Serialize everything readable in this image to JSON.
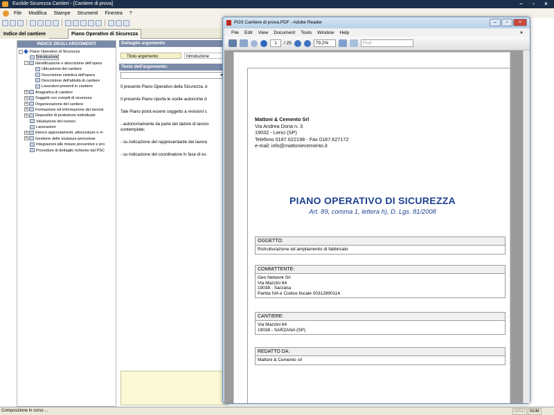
{
  "app": {
    "title": "Euclide Sicurezza Cantieri - [Cantiere di prova]"
  },
  "menubar": [
    "File",
    "Modifica",
    "Stampe",
    "Strumenti",
    "Finestra",
    "?"
  ],
  "tabs": [
    "Indice del cantiere",
    "Piano Operativo di Sicurezza"
  ],
  "left": {
    "header": "INDICE DEGLI ARGOMENTI",
    "tree": [
      "Piano Operativo di Sicurezza",
      "Introduzione",
      "Identificazione e descrizione dell'opera",
      "Ubicazione del cantiere",
      "Descrizione sintetica dell'opera",
      "Descrizione dell'attività di cantiere",
      "Lavoratori presenti in cantiere",
      "Anagrafica di cantiere",
      "Soggetti con compiti di sicurezza",
      "Organizzazione del cantiere",
      "Formazione ed informazione dei lavorat",
      "Dispositivi di protezione individuale",
      "Valutazione del rumore",
      "Lavorazioni",
      "Elenco apprestamenti, attrezzature e m",
      "Gestione delle sostanze pericolose",
      "Integrazioni alle misure preventive e pro",
      "Procedure di dettaglio richieste dal PSC"
    ]
  },
  "middle": {
    "header": "Dettaglio argomento",
    "title_label": "Titolo argomento:",
    "title_value": "Introduzione",
    "text_header": "Testo dell'argomento:",
    "paragraphs": [
      "Il presente Piano Operativo della Sicurezza, è",
      "Il presente Piano riporta le scelte autonome d",
      "Tale Piano potrà essere soggetto a revisioni c",
      "- autonomamente da parte del datore di lavoro",
      "contemplate;",
      "- su indicazione del rappresentante dei lavora",
      "- su indicazione del coordinatore in fase di es"
    ]
  },
  "status": {
    "text": "Composizione in corso ...",
    "caps": "MAIU",
    "num": "NUM"
  },
  "reader": {
    "title": "POS Cantiere di prova.PDF - Adobe Reader",
    "menu": [
      "File",
      "Edit",
      "View",
      "Document",
      "Tools",
      "Window",
      "Help"
    ],
    "page_current": "1",
    "page_total": "/ 25",
    "zoom": "79,2%",
    "find_placeholder": "Find"
  },
  "pdf": {
    "company_name": "Mattoni & Cemento Srl",
    "company_lines": [
      "Via Andrea Doria n. 3",
      "19032 - Lerici (SP)",
      "Telefono 0187.622198 - Fax 0187.627172",
      "e-mail: info@mattoniecemento.it"
    ],
    "title": "PIANO OPERATIVO DI SICUREZZA",
    "subtitle": "Art. 89, comma 1, lettera h), D. Lgs. 81/2008",
    "sections": [
      {
        "heading": "OGGETTO:",
        "lines": [
          "Ristrutturazione ed ampliamento di fabbricato"
        ]
      },
      {
        "heading": "COMMITTENTE:",
        "lines": [
          "Geo Network Srl",
          "Via Mazzini 64",
          "19038 - Sarzana",
          "Partita IVA e Codice fiscale 00312890114"
        ]
      },
      {
        "heading": "CANTIERE:",
        "lines": [
          "Via Mazzini 64",
          "19038 - SARZANA (SP)"
        ]
      },
      {
        "heading": "REDATTO DA:",
        "lines": [
          "Mattoni & Cemento srl"
        ]
      }
    ]
  },
  "colors": {
    "header_blue": "#7a8aa8",
    "pdf_title": "#1b3f8e",
    "note_yellow": "#fbf9d6"
  }
}
